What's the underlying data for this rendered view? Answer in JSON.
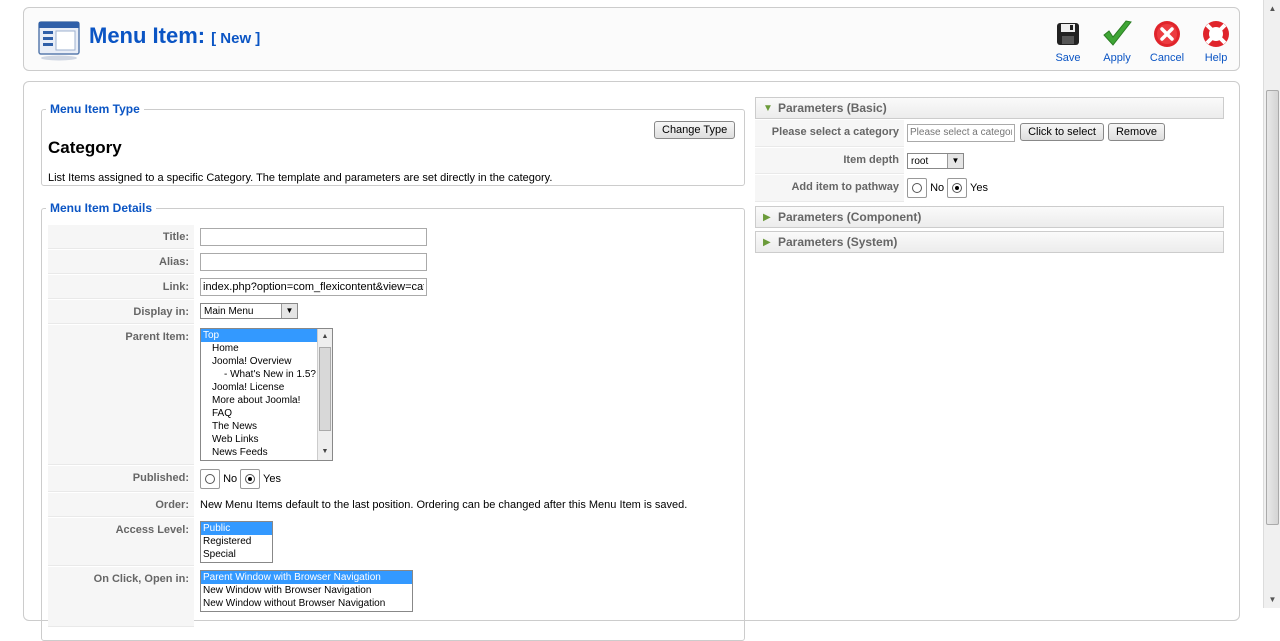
{
  "header": {
    "title": "Menu Item:",
    "subtitle": "[ New ]",
    "buttons": [
      {
        "label": "Save",
        "icon": "save-icon"
      },
      {
        "label": "Apply",
        "icon": "apply-icon"
      },
      {
        "label": "Cancel",
        "icon": "cancel-icon"
      },
      {
        "label": "Help",
        "icon": "help-icon"
      }
    ]
  },
  "type_section": {
    "legend": "Menu Item Type",
    "type_name": "Category",
    "change_button": "Change Type",
    "description": "List Items assigned to a specific Category. The template and parameters are set directly in the category."
  },
  "details": {
    "legend": "Menu Item Details",
    "title_label": "Title:",
    "title_value": "",
    "alias_label": "Alias:",
    "alias_value": "",
    "link_label": "Link:",
    "link_value": "index.php?option=com_flexicontent&view=cate",
    "display_label": "Display in:",
    "display_value": "Main Menu",
    "parent_label": "Parent Item:",
    "parent_options": [
      "Top",
      "Home",
      "Joomla! Overview",
      "- What's New in 1.5?",
      "Joomla! License",
      "More about Joomla!",
      "FAQ",
      "The News",
      "Web Links",
      "News Feeds"
    ],
    "parent_selected": 0,
    "published_label": "Published:",
    "published_no": "No",
    "published_yes": "Yes",
    "published_value": "Yes",
    "order_label": "Order:",
    "order_text": "New Menu Items default to the last position. Ordering can be changed after this Menu Item is saved.",
    "access_label": "Access Level:",
    "access_options": [
      "Public",
      "Registered",
      "Special"
    ],
    "access_selected": 0,
    "onclick_label": "On Click, Open in:",
    "onclick_options": [
      "Parent Window with Browser Navigation",
      "New Window with Browser Navigation",
      "New Window without Browser Navigation"
    ],
    "onclick_selected": 0
  },
  "params": {
    "basic_title": "Parameters (Basic)",
    "category_label": "Please select a category",
    "category_placeholder": "Please select a category",
    "click_to_select": "Click to select",
    "remove": "Remove",
    "depth_label": "Item depth",
    "depth_value": "root",
    "pathway_label": "Add item to pathway",
    "pathway_no": "No",
    "pathway_yes": "Yes",
    "pathway_value": "Yes",
    "component_title": "Parameters (Component)",
    "system_title": "Parameters (System)"
  },
  "colors": {
    "accent": "#0b55c4",
    "selection": "#3399ff"
  }
}
